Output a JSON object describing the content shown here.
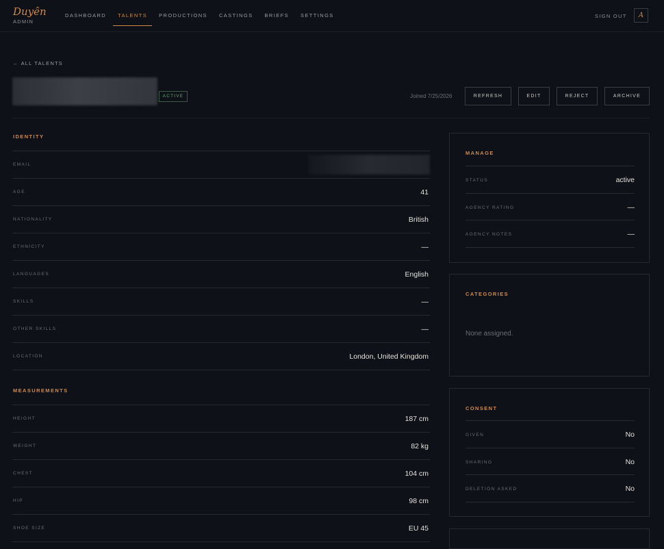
{
  "brand": {
    "name": "Duyên",
    "subtitle": "ADMIN"
  },
  "nav": {
    "items": [
      "DASHBOARD",
      "TALENTS",
      "PRODUCTIONS",
      "CASTINGS",
      "BRIEFS",
      "SETTINGS"
    ],
    "active": "TALENTS",
    "sign_out": "SIGN OUT",
    "avatar_letter": "A"
  },
  "colors": {
    "accent": "#d08a47",
    "background": "#0e1117",
    "status_active": "#5fa878"
  },
  "page": {
    "back_link": "← ALL TALENTS",
    "status_badge": "ACTIVE",
    "joined": "Joined 7/25/2026",
    "actions": {
      "refresh": "REFRESH",
      "edit": "EDIT",
      "reject": "REJECT",
      "archive": "ARCHIVE"
    }
  },
  "identity": {
    "title": "IDENTITY",
    "rows": [
      {
        "label": "EMAIL",
        "value": ""
      },
      {
        "label": "AGE",
        "value": "41"
      },
      {
        "label": "NATIONALITY",
        "value": "British"
      },
      {
        "label": "ETHNICITY",
        "value": "—"
      },
      {
        "label": "LANGUAGES",
        "value": "English"
      },
      {
        "label": "SKILLS",
        "value": "—"
      },
      {
        "label": "OTHER SKILLS",
        "value": "—"
      },
      {
        "label": "LOCATION",
        "value": "London, United Kingdom"
      }
    ]
  },
  "measurements": {
    "title": "MEASUREMENTS",
    "rows": [
      {
        "label": "HEIGHT",
        "value": "187 cm"
      },
      {
        "label": "WEIGHT",
        "value": "82 kg"
      },
      {
        "label": "CHEST",
        "value": "104 cm"
      },
      {
        "label": "HIP",
        "value": "98 cm"
      },
      {
        "label": "SHOE SIZE",
        "value": "EU 45"
      }
    ]
  },
  "manage": {
    "title": "MANAGE",
    "rows": [
      {
        "label": "STATUS",
        "value": "active"
      },
      {
        "label": "AGENCY RATING",
        "value": "—"
      },
      {
        "label": "AGENCY NOTES",
        "value": "—"
      }
    ]
  },
  "categories": {
    "title": "CATEGORIES",
    "empty_text": "None assigned."
  },
  "consent": {
    "title": "CONSENT",
    "rows": [
      {
        "label": "GIVEN",
        "value": "No"
      },
      {
        "label": "SHARING",
        "value": "No"
      },
      {
        "label": "DELETION ASKED",
        "value": "No"
      }
    ]
  }
}
